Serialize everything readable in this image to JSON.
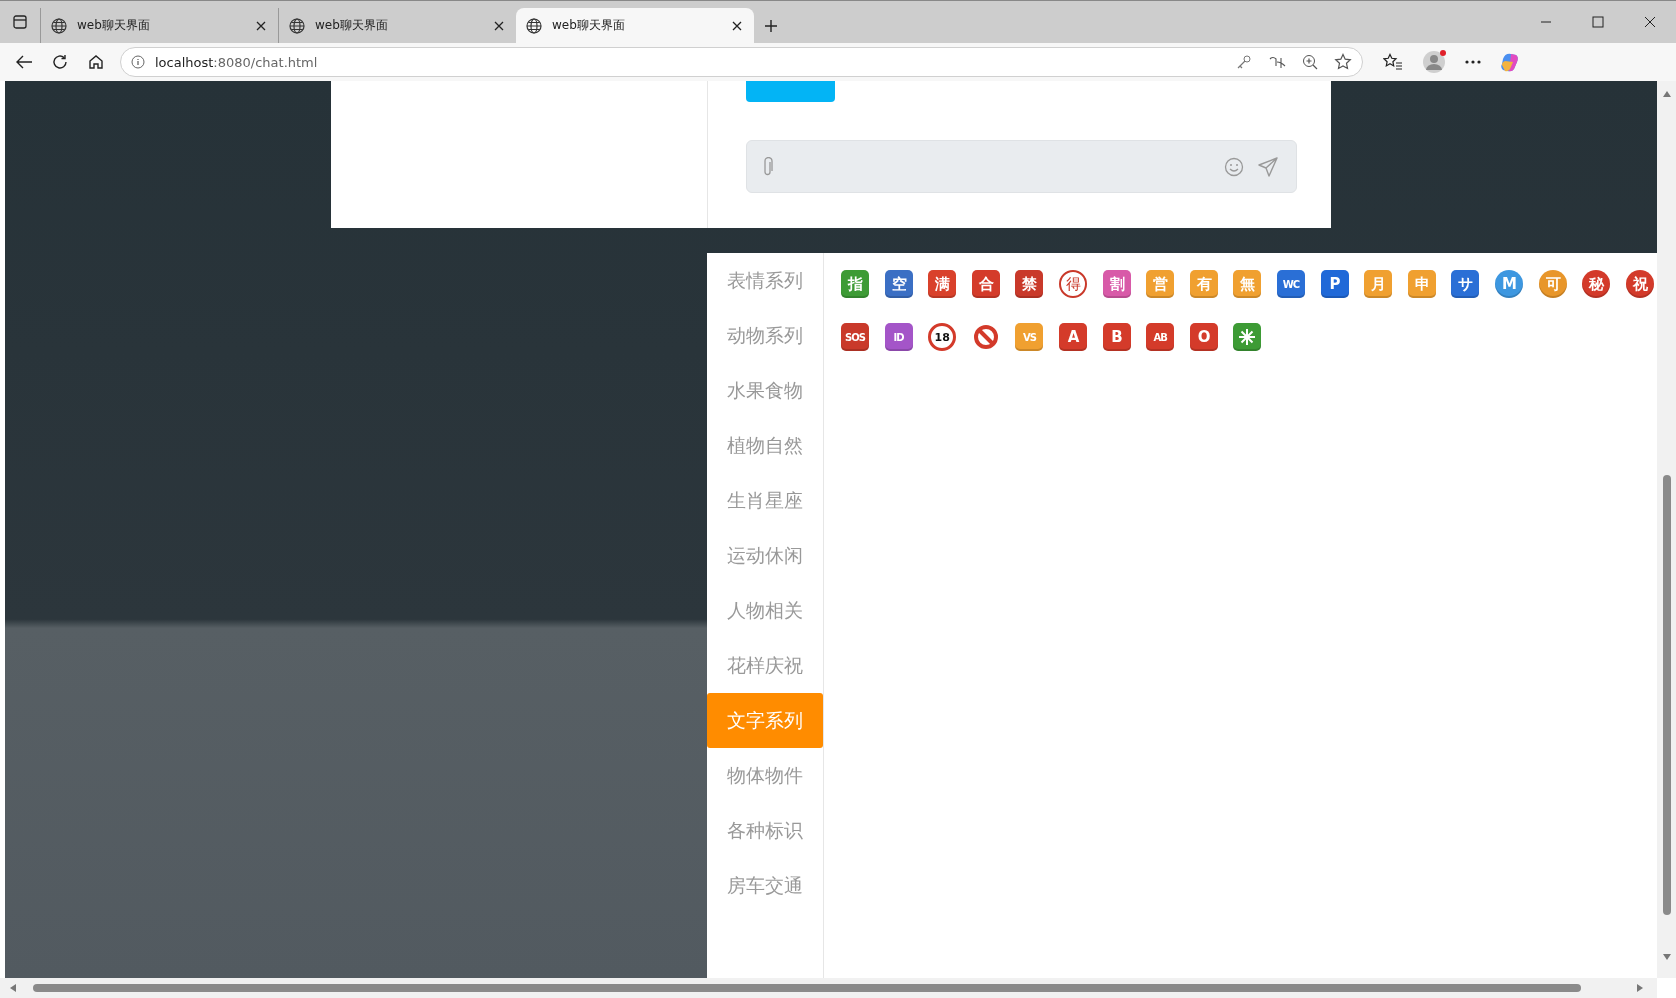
{
  "browser": {
    "tabs": [
      {
        "title": "web聊天界面",
        "selected": false
      },
      {
        "title": "web聊天界面",
        "selected": false
      },
      {
        "title": "web聊天界面",
        "selected": true
      }
    ],
    "address": {
      "host": "localhost",
      "path": ":8080/chat.html"
    }
  },
  "emoji_panel": {
    "categories": [
      {
        "label": "表情系列",
        "selected": false
      },
      {
        "label": "动物系列",
        "selected": false
      },
      {
        "label": "水果食物",
        "selected": false
      },
      {
        "label": "植物自然",
        "selected": false
      },
      {
        "label": "生肖星座",
        "selected": false
      },
      {
        "label": "运动休闲",
        "selected": false
      },
      {
        "label": "人物相关",
        "selected": false
      },
      {
        "label": "花样庆祝",
        "selected": false
      },
      {
        "label": "文字系列",
        "selected": true
      },
      {
        "label": "物体物件",
        "selected": false
      },
      {
        "label": "各种标识",
        "selected": false
      },
      {
        "label": "房车交通",
        "selected": false
      }
    ],
    "emojis": [
      {
        "kind": "square",
        "label": "指",
        "color": "#3d9b35"
      },
      {
        "kind": "square",
        "label": "空",
        "color": "#3b6fc4"
      },
      {
        "kind": "square",
        "label": "满",
        "color": "#d9412b"
      },
      {
        "kind": "square",
        "label": "合",
        "color": "#d43b2a"
      },
      {
        "kind": "square",
        "label": "禁",
        "color": "#c9392a"
      },
      {
        "kind": "ring",
        "label": "得",
        "color": "#c9392a"
      },
      {
        "kind": "square",
        "label": "割",
        "color": "#d85aa8"
      },
      {
        "kind": "square",
        "label": "営",
        "color": "#f0a030"
      },
      {
        "kind": "square",
        "label": "有",
        "color": "#f0a030"
      },
      {
        "kind": "square",
        "label": "無",
        "color": "#f0a030"
      },
      {
        "kind": "square",
        "label": "WC",
        "color": "#2a6fd6"
      },
      {
        "kind": "square",
        "label": "P",
        "color": "#2069d8"
      },
      {
        "kind": "square",
        "label": "月",
        "color": "#f0a030"
      },
      {
        "kind": "square",
        "label": "申",
        "color": "#f0a030"
      },
      {
        "kind": "square",
        "label": "サ",
        "color": "#2a6fd6"
      },
      {
        "kind": "circle",
        "label": "M",
        "color": "#3d97e0"
      },
      {
        "kind": "circle",
        "label": "可",
        "color": "#e8962a"
      },
      {
        "kind": "circle",
        "label": "秘",
        "color": "#d33a2a"
      },
      {
        "kind": "circle",
        "label": "祝",
        "color": "#d33a2a"
      },
      {
        "kind": "square",
        "label": "SOS",
        "color": "#c9392a"
      },
      {
        "kind": "square",
        "label": "ID",
        "color": "#a455c8"
      },
      {
        "kind": "no18",
        "label": "18",
        "color": "#d33a2a"
      },
      {
        "kind": "prohibited",
        "color": "#d33a2a"
      },
      {
        "kind": "square",
        "label": "VS",
        "color": "#f0a030"
      },
      {
        "kind": "square",
        "label": "A",
        "color": "#d43b2a"
      },
      {
        "kind": "square",
        "label": "B",
        "color": "#d43b2a"
      },
      {
        "kind": "square",
        "label": "AB",
        "color": "#d43b2a"
      },
      {
        "kind": "square",
        "label": "O",
        "color": "#d43b2a"
      },
      {
        "kind": "asterisk",
        "color": "#3d9b35"
      }
    ]
  }
}
